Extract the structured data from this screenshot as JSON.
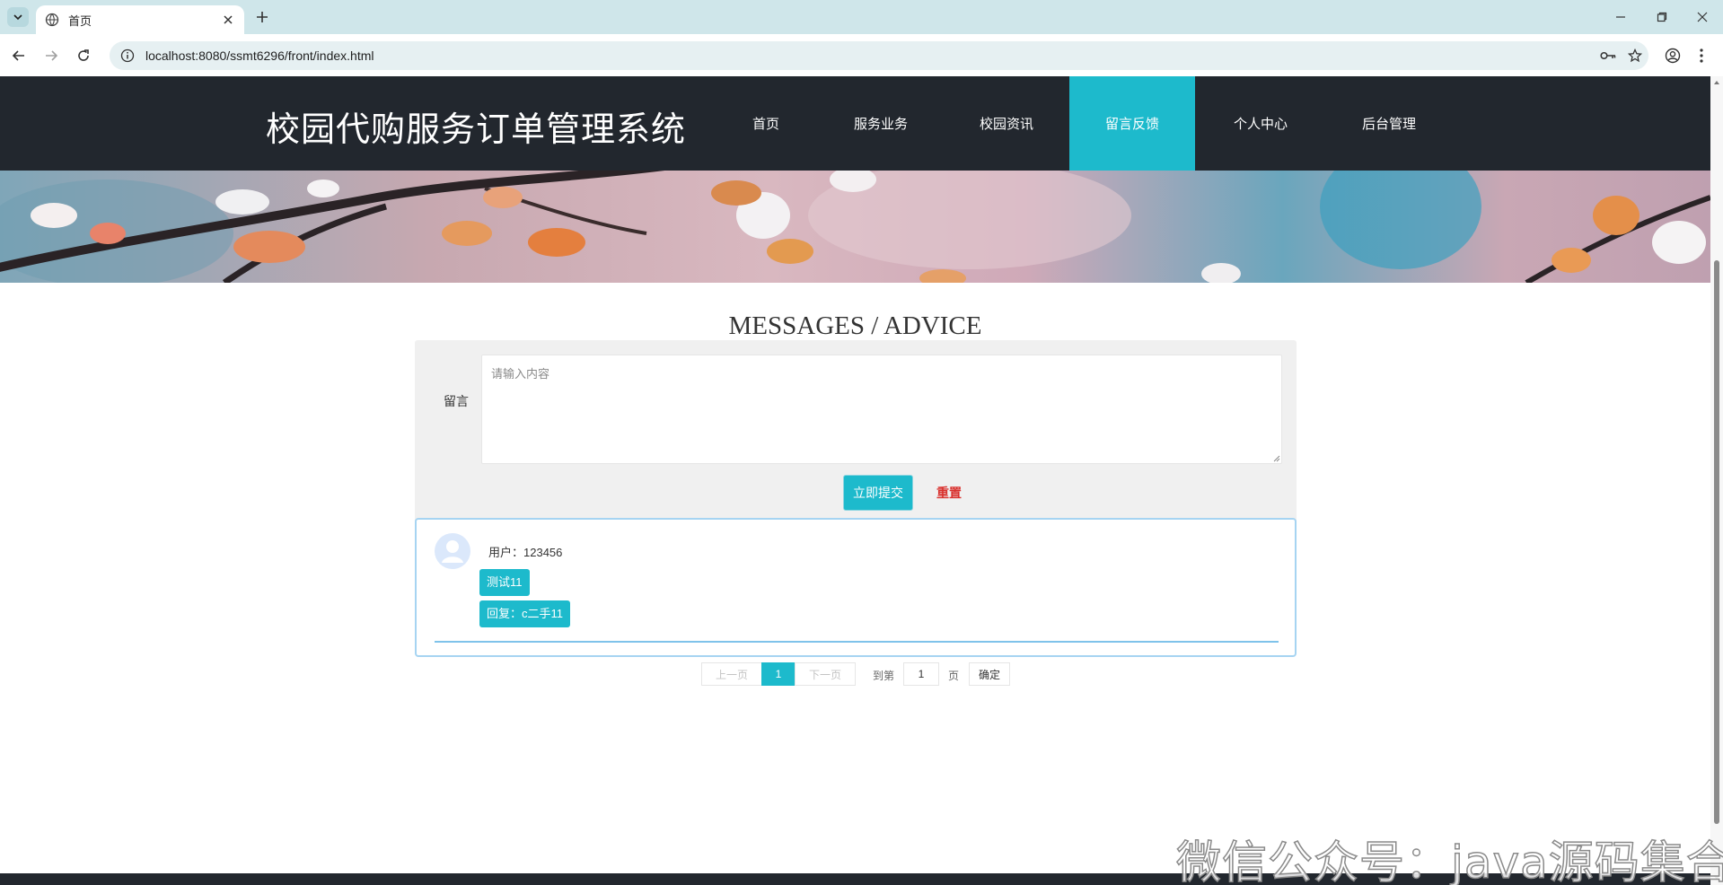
{
  "browser": {
    "tab_title": "首页",
    "url": "localhost:8080/ssmt6296/front/index.html"
  },
  "site": {
    "title": "校园代购服务订单管理系统",
    "nav": [
      {
        "label": "首页",
        "active": false
      },
      {
        "label": "服务业务",
        "active": false
      },
      {
        "label": "校园资讯",
        "active": false
      },
      {
        "label": "留言反馈",
        "active": true
      },
      {
        "label": "个人中心",
        "active": false
      },
      {
        "label": "后台管理",
        "active": false
      }
    ]
  },
  "section": {
    "title_en": "MESSAGES / ADVICE",
    "title_cn": "留言反馈"
  },
  "form": {
    "label": "留言",
    "placeholder": "请输入内容",
    "value": "",
    "submit_label": "立即提交",
    "reset_label": "重置"
  },
  "messages": [
    {
      "user_label": "用户：123456",
      "content": "测试11",
      "reply": "回复：c二手11"
    }
  ],
  "pagination": {
    "prev_label": "上一页",
    "current": "1",
    "next_label": "下一页",
    "goto_label": "到第",
    "goto_value": "1",
    "page_unit": "页",
    "confirm_label": "确定"
  },
  "watermark": "微信公众号：java源码集合",
  "colors": {
    "accent": "#1dbacc",
    "header_bg": "#22272e",
    "reset": "#d9302c"
  }
}
